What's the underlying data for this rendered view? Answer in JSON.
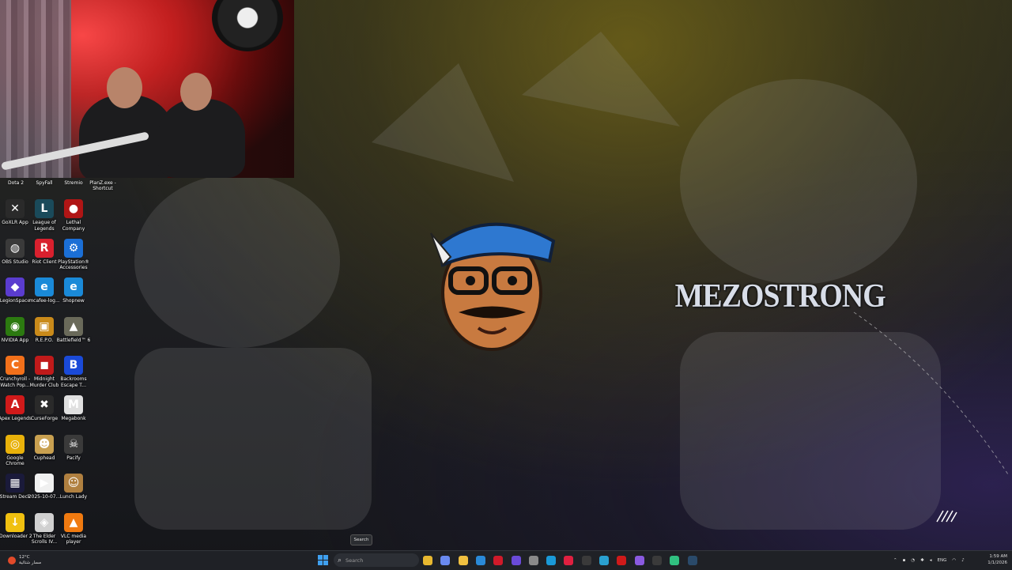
{
  "wallpaper": {
    "brand_text": "MEZOSTRONG"
  },
  "desktop": {
    "top_row": [
      {
        "label": "Dota 2"
      },
      {
        "label": "SpyFall"
      },
      {
        "label": "Stremio"
      },
      {
        "label": "PlanZ.exe - Shortcut"
      }
    ],
    "icons": [
      {
        "label": "GoXLR App",
        "icon": "goxlr-icon",
        "color": "#2a2a2a",
        "glyph": "✕"
      },
      {
        "label": "League of Legends",
        "icon": "league-of-legends-icon",
        "color": "#1a4a5a",
        "glyph": "L"
      },
      {
        "label": "Lethal Company",
        "icon": "lethal-company-icon",
        "color": "#b01515",
        "glyph": "●"
      },
      {
        "label": "OBS Studio",
        "icon": "obs-icon",
        "color": "#3a3a3a",
        "glyph": "◍"
      },
      {
        "label": "Riot Client",
        "icon": "riot-client-icon",
        "color": "#d9202e",
        "glyph": "R"
      },
      {
        "label": "PlayStation® Accessories",
        "icon": "playstation-icon",
        "color": "#1b6fd6",
        "glyph": "⚙"
      },
      {
        "label": "LegionSpace",
        "icon": "legionspace-icon",
        "color": "#5a3ccf",
        "glyph": "◆"
      },
      {
        "label": "mcafee-log...",
        "icon": "edge-icon",
        "color": "#1a8ad8",
        "glyph": "e"
      },
      {
        "label": "Shopnew",
        "icon": "edge-icon",
        "color": "#1a8ad8",
        "glyph": "e"
      },
      {
        "label": "NVIDIA App",
        "icon": "nvidia-icon",
        "color": "#2c7a10",
        "glyph": "◉"
      },
      {
        "label": "R.E.P.O.",
        "icon": "repo-icon",
        "color": "#c98a1a",
        "glyph": "▣"
      },
      {
        "label": "Battlefield™ 6",
        "icon": "battlefield-icon",
        "color": "#6a6a5a",
        "glyph": "▲"
      },
      {
        "label": "Crunchyroll - Watch Pop...",
        "icon": "crunchyroll-icon",
        "color": "#f2701a",
        "glyph": "C"
      },
      {
        "label": "Midnight Murder Club",
        "icon": "midnight-murder-club-icon",
        "color": "#c01a1a",
        "glyph": "◼"
      },
      {
        "label": "Backrooms Escape T...",
        "icon": "backrooms-icon",
        "color": "#1a4ad8",
        "glyph": "B"
      },
      {
        "label": "Apex Legends",
        "icon": "apex-icon",
        "color": "#d01a1a",
        "glyph": "A"
      },
      {
        "label": "CurseForge",
        "icon": "curseforge-icon",
        "color": "#2a2a2a",
        "glyph": "✖"
      },
      {
        "label": "Megabonk",
        "icon": "megabonk-icon",
        "color": "#e0e0e0",
        "glyph": "M"
      },
      {
        "label": "Google Chrome",
        "icon": "chrome-icon",
        "color": "#e8b10a",
        "glyph": "◎"
      },
      {
        "label": "Cuphead",
        "icon": "cuphead-icon",
        "color": "#c8a050",
        "glyph": "☻"
      },
      {
        "label": "Pacify",
        "icon": "pacify-icon",
        "color": "#3a3a3a",
        "glyph": "☠"
      },
      {
        "label": "Stream Deck",
        "icon": "stream-deck-icon",
        "color": "#1a1a3a",
        "glyph": "▦"
      },
      {
        "label": "2025-10-07...",
        "icon": "video-file-icon",
        "color": "#f0f0f0",
        "glyph": "▶"
      },
      {
        "label": "Lunch Lady",
        "icon": "lunch-lady-icon",
        "color": "#b08040",
        "glyph": "☺"
      },
      {
        "label": "JDownloader 2",
        "icon": "jdownloader-icon",
        "color": "#f0c010",
        "glyph": "↓"
      },
      {
        "label": "The Elder Scrolls IV...",
        "icon": "elder-scrolls-icon",
        "color": "#d0d0d0",
        "glyph": "◈"
      },
      {
        "label": "VLC media player",
        "icon": "vlc-icon",
        "color": "#f07a10",
        "glyph": "▲"
      }
    ]
  },
  "taskbar": {
    "weather_temp": "12°C",
    "weather_desc": "مسار شتائية",
    "search_placeholder": "Search",
    "search_tooltip": "Search",
    "language": "ENG",
    "time": "1:59 AM",
    "date": "1/1/2026",
    "pinned": [
      {
        "icon": "file-explorer-icon",
        "color": "#e8b830"
      },
      {
        "icon": "copilot-icon",
        "color": "#6a8af0"
      },
      {
        "icon": "folder-icon",
        "color": "#f0c040"
      },
      {
        "icon": "microsoft-store-icon",
        "color": "#2a8ad8"
      },
      {
        "icon": "mcafee-icon",
        "color": "#d01a2a"
      },
      {
        "icon": "proton-vpn-icon",
        "color": "#6a4ad8"
      },
      {
        "icon": "settings-icon",
        "color": "#8a8a8a"
      },
      {
        "icon": "edge-icon",
        "color": "#1a9ad8"
      },
      {
        "icon": "opera-gx-icon",
        "color": "#e02040"
      },
      {
        "icon": "obs-taskbar-icon",
        "color": "#3a3a3a"
      },
      {
        "icon": "edge-taskbar-icon",
        "color": "#2aa0d0"
      },
      {
        "icon": "netflix-icon",
        "color": "#d01a1a"
      },
      {
        "icon": "messenger-icon",
        "color": "#8a5ae0"
      },
      {
        "icon": "terminal-icon",
        "color": "#3a3a3a"
      },
      {
        "icon": "streamlabs-icon",
        "color": "#30c080"
      },
      {
        "icon": "steam-icon",
        "color": "#2a4a6a"
      }
    ]
  }
}
